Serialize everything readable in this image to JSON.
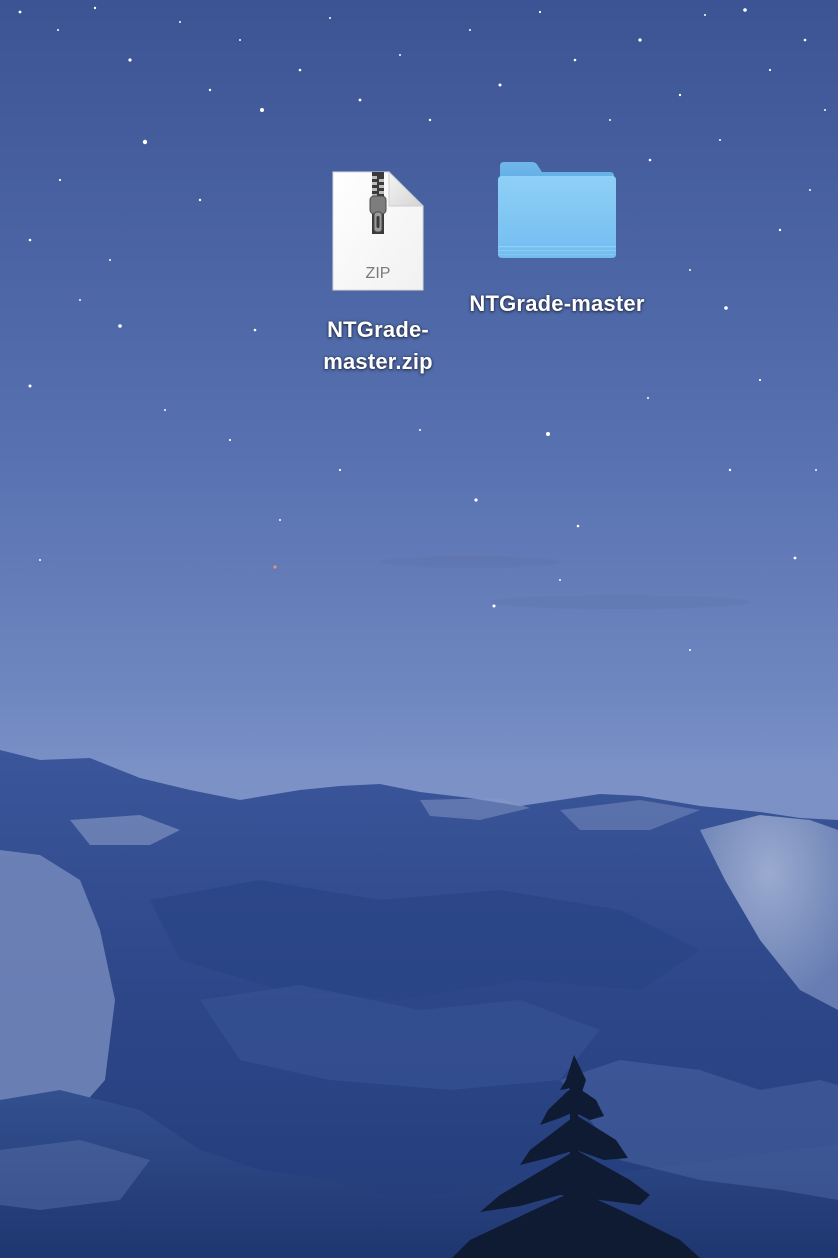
{
  "desktop": {
    "wallpaper": "mountain-night-sky-wallpaper",
    "colors": {
      "sky_top": "#3d5596",
      "sky_mid": "#6079b6",
      "horizon": "#7d93c6",
      "mountain_dark": "#243f7d",
      "mountain_light": "#8da0c8"
    },
    "items": [
      {
        "type": "file",
        "icon": "zip-archive-icon",
        "icon_text": "ZIP",
        "label": "NTGrade-master.zip",
        "label_line1": "NTGrade-",
        "label_line2": "master.zip"
      },
      {
        "type": "folder",
        "icon": "folder-icon",
        "label": "NTGrade-master",
        "folder_color": "#7cc4f2"
      }
    ]
  }
}
